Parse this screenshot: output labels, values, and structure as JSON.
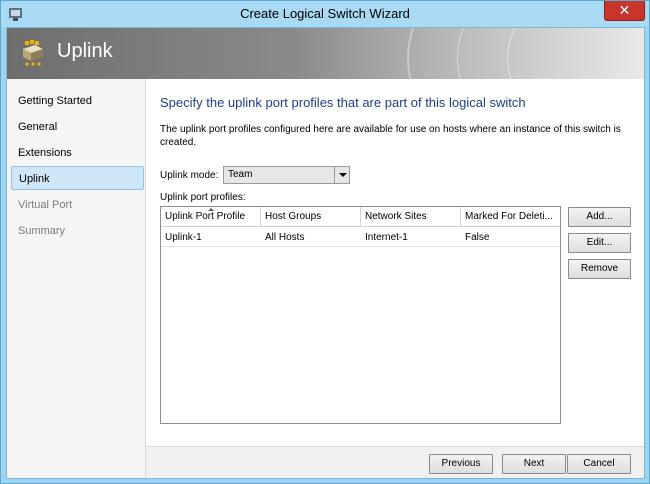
{
  "window": {
    "title": "Create Logical Switch Wizard",
    "close_glyph": "✕",
    "app_icon": "wizard-icon"
  },
  "banner": {
    "title": "Uplink",
    "icon": "logical-switch-icon"
  },
  "sidebar": {
    "items": [
      {
        "label": "Getting Started",
        "state": "done"
      },
      {
        "label": "General",
        "state": "done"
      },
      {
        "label": "Extensions",
        "state": "done"
      },
      {
        "label": "Uplink",
        "state": "active"
      },
      {
        "label": "Virtual Port",
        "state": "disabled"
      },
      {
        "label": "Summary",
        "state": "disabled"
      }
    ]
  },
  "main": {
    "heading": "Specify the uplink port profiles that are part of this logical switch",
    "description": "The uplink port profiles configured here are available for use on hosts where an instance of this switch is created.",
    "uplink_mode": {
      "label": "Uplink mode:",
      "value": "Team"
    },
    "profiles_label": "Uplink port profiles:",
    "grid": {
      "columns": [
        "Uplink Port Profile",
        "Host Groups",
        "Network Sites",
        "Marked For Deleti..."
      ],
      "rows": [
        [
          "Uplink-1",
          "All Hosts",
          "Internet-1",
          "False"
        ]
      ]
    },
    "buttons": {
      "add": "Add...",
      "edit": "Edit...",
      "remove": "Remove"
    }
  },
  "footer": {
    "previous": "Previous",
    "next": "Next",
    "cancel": "Cancel"
  },
  "colors": {
    "heading": "#1e3f8a",
    "title_bar": "#a9daf4",
    "close": "#c7352c",
    "active_nav": "#cfe6f8"
  }
}
